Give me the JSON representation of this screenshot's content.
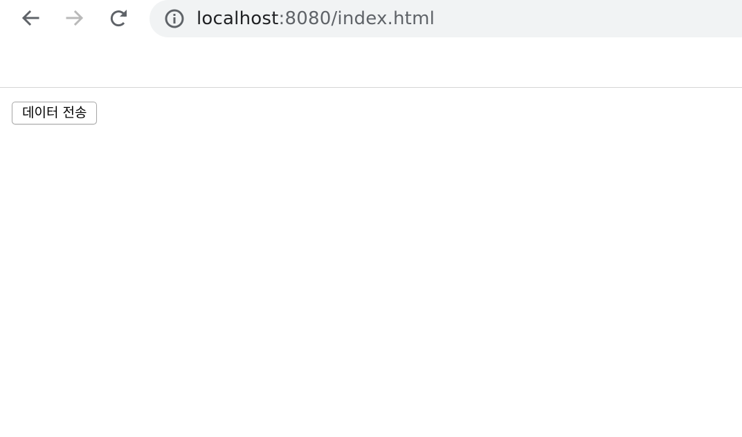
{
  "browser": {
    "url_host": "localhost",
    "url_path": ":8080/index.html",
    "icons": {
      "back": "arrow-left-icon",
      "forward": "arrow-right-icon",
      "reload": "reload-icon",
      "info": "info-circle-icon"
    },
    "colors": {
      "address_bar_bg": "#f1f3f4",
      "icon_active": "#5f6368",
      "icon_disabled": "#b9b9b9"
    }
  },
  "page": {
    "send_button_label": "데이터 전송"
  }
}
